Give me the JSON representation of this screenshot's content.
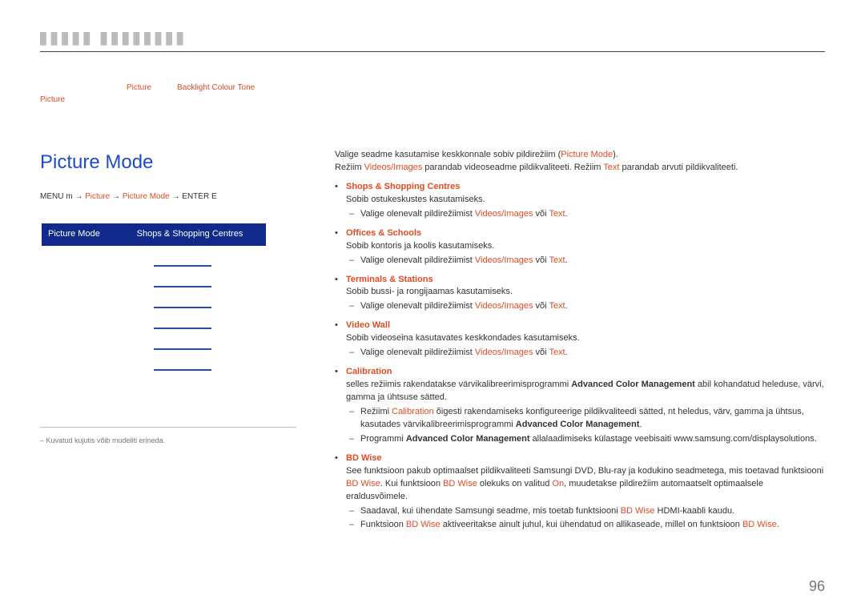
{
  "chapter": {
    "blurred": "▌▌▌▌▌▐▐▐▐▐▐▐▐"
  },
  "intro": {
    "picture1": "Picture",
    "middle": "Backlight  Colour Tone",
    "picture2": "Picture"
  },
  "left": {
    "option_title": "Picture Mode",
    "bc_prefix": "MENU m → ",
    "bc_picture": "Picture",
    "bc_arrow1": " → ",
    "bc_mode": "Picture Mode",
    "bc_arrow2": " → ENTER E",
    "sel_label": "Picture Mode",
    "sel_value": "Shops & Shopping Centres",
    "footnote": "– Kuvatud kujutis võib mudeliti erineda."
  },
  "right": {
    "p1a": "Valige seadme kasutamise keskkonnale sobiv pildirežiim (",
    "p1b": "Picture Mode",
    "p1c": ").",
    "p2a": "Režiim ",
    "p2b": "Videos/Images",
    "p2c": " parandab videoseadme pildikvaliteeti. Režiim ",
    "p2d": "Text",
    "p2e": " parandab arvuti pildikvaliteeti.",
    "items": {
      "shops": {
        "title": "Shops & Shopping Centres",
        "line": "Sobib ostukeskustes kasutamiseks.",
        "sub_a": "Valige olenevalt pildirežiimist ",
        "sub_b": "Videos/Images",
        "sub_c": " või ",
        "sub_d": "Text",
        "sub_e": "."
      },
      "offices": {
        "title": "Offices & Schools",
        "line": "Sobib kontoris ja koolis kasutamiseks.",
        "sub_a": "Valige olenevalt pildirežiimist ",
        "sub_b": "Videos/Images",
        "sub_c": " või ",
        "sub_d": "Text",
        "sub_e": "."
      },
      "terminals": {
        "title": "Terminals & Stations",
        "line": "Sobib bussi- ja rongijaamas kasutamiseks.",
        "sub_a": "Valige olenevalt pildirežiimist ",
        "sub_b": "Videos/Images",
        "sub_c": " või ",
        "sub_d": "Text",
        "sub_e": "."
      },
      "videowall": {
        "title": "Video Wall",
        "line": "Sobib videoseina kasutavates keskkondades kasutamiseks.",
        "sub_a": "Valige olenevalt pildirežiimist ",
        "sub_b": "Videos/Images",
        "sub_c": " või ",
        "sub_d": "Text",
        "sub_e": "."
      },
      "calibration": {
        "title": "Calibration",
        "line_a": "selles režiimis rakendatakse värvikalibreerimisprogrammi ",
        "line_b": "Advanced Color Management",
        "line_c": " abil kohandatud heleduse, värvi, gamma ja ühtsuse sätted.",
        "sub1_a": "Režiimi ",
        "sub1_b": "Calibration",
        "sub1_c": " õigesti rakendamiseks konfigureerige pildikvaliteedi sätted, nt heledus, värv, gamma ja ühtsus, kasutades värvikalibreerimisprogrammi ",
        "sub1_d": "Advanced Color Management",
        "sub1_e": ".",
        "sub2_a": "Programmi ",
        "sub2_b": "Advanced Color Management",
        "sub2_c": " allalaadimiseks külastage veebisaiti www.samsung.com/displaysolutions."
      },
      "bdwise": {
        "title": "BD Wise",
        "line_a": "See funktsioon pakub optimaalset pildikvaliteeti Samsungi DVD, Blu-ray ja kodukino seadmetega, mis toetavad funktsiooni ",
        "line_b": "BD Wise",
        "line_c": ". Kui funktsioon ",
        "line_d": "BD Wise",
        "line_e": " olekuks on valitud ",
        "line_f": "On",
        "line_g": ", muudetakse pildirežiim automaatselt optimaalsele eraldusvõimele.",
        "sub1_a": "Saadaval, kui ühendate Samsungi seadme, mis toetab funktsiooni ",
        "sub1_b": "BD Wise",
        "sub1_c": " HDMI-kaabli kaudu.",
        "sub2_a": "Funktsioon ",
        "sub2_b": "BD Wise",
        "sub2_c": " aktiveeritakse ainult juhul, kui ühendatud on allikaseade, millel on funktsioon ",
        "sub2_d": "BD Wise",
        "sub2_e": "."
      }
    }
  },
  "page_number": "96"
}
